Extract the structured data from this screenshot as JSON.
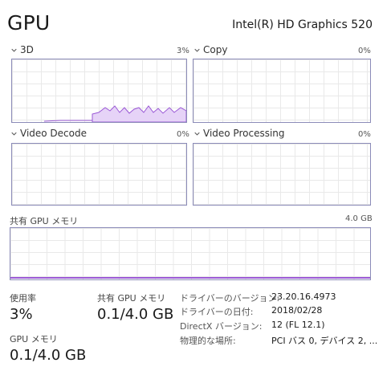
{
  "header": {
    "title": "GPU",
    "adapter_name": "Intel(R) HD Graphics 520"
  },
  "engines": [
    {
      "label": "3D",
      "percent": "3%"
    },
    {
      "label": "Copy",
      "percent": "0%"
    },
    {
      "label": "Video Decode",
      "percent": "0%"
    },
    {
      "label": "Video Processing",
      "percent": "0%"
    }
  ],
  "shared_memory": {
    "label": "共有 GPU メモリ",
    "max": "4.0 GB"
  },
  "stats": {
    "utilization_label": "使用率",
    "utilization_value": "3%",
    "shared_memory_label": "共有 GPU メモリ",
    "shared_memory_value": "0.1/4.0 GB",
    "gpu_memory_label": "GPU メモリ",
    "gpu_memory_value": "0.1/4.0 GB"
  },
  "details": [
    {
      "key": "ドライバーのバージョン:",
      "value": "23.20.16.4973"
    },
    {
      "key": "ドライバーの日付:",
      "value": "2018/02/28"
    },
    {
      "key": "DirectX バージョン:",
      "value": "12 (FL 12.1)"
    },
    {
      "key": "物理的な場所:",
      "value": "PCI バス 0, デバイス 2, ..."
    }
  ],
  "colors": {
    "graph_border": "#8b8bb8",
    "graph_line": "#9b59d6",
    "graph_fill": "#e6d3f7"
  }
}
